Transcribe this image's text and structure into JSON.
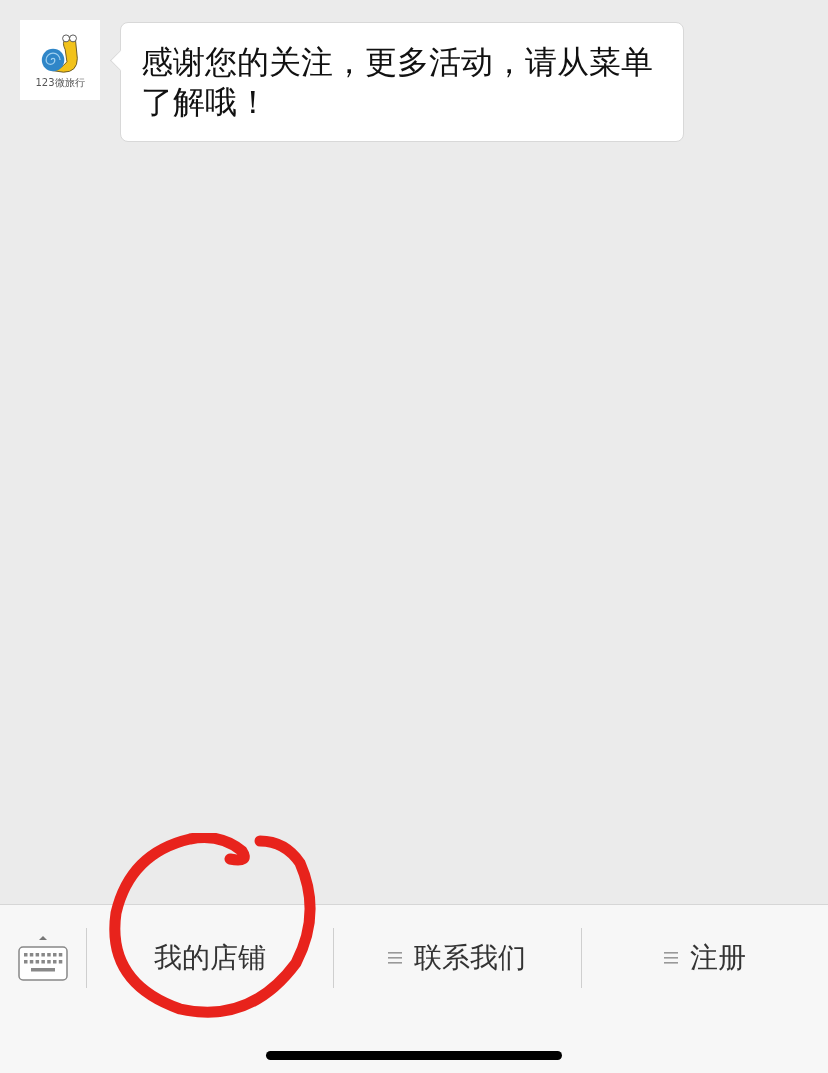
{
  "chat": {
    "messages": [
      {
        "avatar_caption": "123微旅行",
        "text": "感谢您的关注，更多活动，请从菜单了解哦！"
      }
    ]
  },
  "menu_bar": {
    "items": [
      {
        "label": "我的店铺",
        "has_submenu": false,
        "circled": true
      },
      {
        "label": "联系我们",
        "has_submenu": true,
        "circled": false
      },
      {
        "label": "注册",
        "has_submenu": true,
        "circled": false
      }
    ]
  }
}
